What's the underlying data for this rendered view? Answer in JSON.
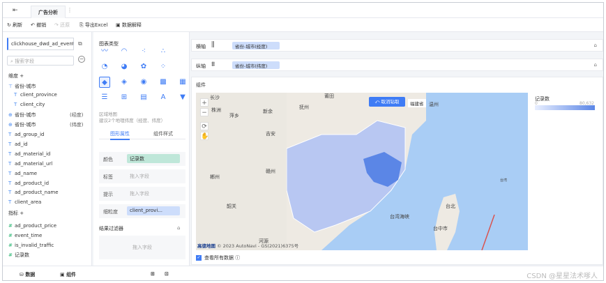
{
  "titlebar": {
    "tab": "广告分析"
  },
  "toolbar": {
    "refresh": "刷新",
    "undo": "撤销",
    "redo": "还原",
    "export": "导出Excel",
    "explain": "数据解释"
  },
  "datasource": {
    "name": "clickhouse_dwd_ad_event_..."
  },
  "search": {
    "placeholder": "搜索字段"
  },
  "dimension_title": "维度",
  "dimensions": [
    {
      "label": "省份-城市",
      "icon": "hierarchy-icon"
    },
    {
      "label": "client_province",
      "icon": "text-icon"
    },
    {
      "label": "client_city",
      "icon": "text-icon"
    },
    {
      "label": "省份-城市",
      "icon": "globe-icon",
      "tag": "(经度)"
    },
    {
      "label": "省份-城市",
      "icon": "globe-icon",
      "tag": "(纬度)"
    },
    {
      "label": "ad_group_id",
      "icon": "text-icon"
    },
    {
      "label": "ad_id",
      "icon": "text-icon"
    },
    {
      "label": "ad_material_id",
      "icon": "text-icon"
    },
    {
      "label": "ad_material_url",
      "icon": "text-icon"
    },
    {
      "label": "ad_name",
      "icon": "text-icon"
    },
    {
      "label": "ad_product_id",
      "icon": "text-icon"
    },
    {
      "label": "ad_product_name",
      "icon": "text-icon"
    },
    {
      "label": "client_area",
      "icon": "text-icon"
    }
  ],
  "measure_title": "指标",
  "measures": [
    {
      "label": "ad_product_price"
    },
    {
      "label": "event_time"
    },
    {
      "label": "is_invalid_traffic"
    },
    {
      "label": "记录数"
    }
  ],
  "chart_type": {
    "title": "图表类型",
    "hint1": "区域地图",
    "hint2": "建议2个地理纬度（经度、纬度）"
  },
  "prop_tabs": {
    "graphic": "图形属性",
    "style": "组件样式"
  },
  "props": {
    "color_label": "颜色",
    "color_value": "记录数",
    "label_label": "标签",
    "label_placeholder": "拖入字段",
    "tip_label": "提示",
    "tip_placeholder": "拖入字段",
    "detail_label": "细粒度",
    "detail_value": "client_provi..."
  },
  "filter": {
    "title": "结果过滤器",
    "placeholder": "拖入字段"
  },
  "axes": {
    "x_label": "横轴",
    "x_value": "省份-城市(经度)",
    "y_label": "纵轴",
    "y_value": "省份-城市(纬度)"
  },
  "component": {
    "title": "组件",
    "cancel": "取消钻取",
    "province": "福建省",
    "legend_title": "记录数",
    "legend_min": "0",
    "legend_max": "80,632",
    "show_all": "查看所有数据",
    "footer_brand": "高德地图",
    "footer_copy": "© 2023 AutoNavi - GS(2021)6375号"
  },
  "map_labels": [
    "长沙",
    "株洲",
    "萍乡",
    "新余",
    "抚州",
    "莆田",
    "温州",
    "吉安",
    "赣州",
    "郴州",
    "韶关",
    "台湾海峡",
    "台北",
    "台中市",
    "河源",
    "台湾"
  ],
  "bottom": {
    "data_tab": "数据",
    "component_tab": "组件"
  },
  "watermark": "CSDN @星星法术嗲人"
}
